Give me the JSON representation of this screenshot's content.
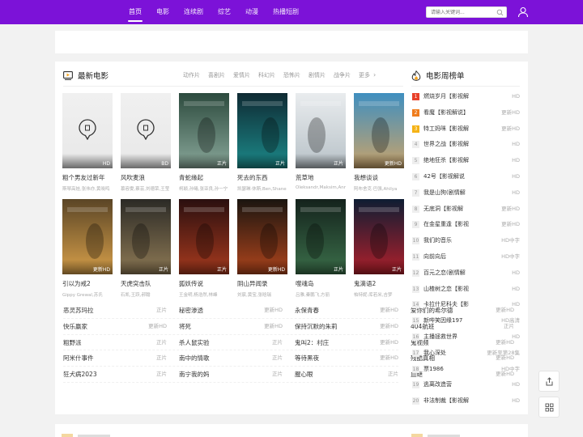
{
  "nav": {
    "items": [
      "首页",
      "电影",
      "连续剧",
      "综艺",
      "动漫",
      "热播短剧"
    ],
    "active": 0
  },
  "search": {
    "placeholder": "请输入关键词..."
  },
  "section": {
    "title": "最新电影",
    "categories": [
      "动作片",
      "喜剧片",
      "爱情片",
      "科幻片",
      "恐怖片",
      "剧情片",
      "战争片",
      "更多"
    ],
    "more_arrow": "›"
  },
  "cards": [
    {
      "title": "粗个男友过新年",
      "cast": "斯琴高娃,张伟亦,黄晓鸣",
      "badge": "HD",
      "placeholder": true,
      "colors": [
        "#f0f0f0",
        "#e8e8e8"
      ]
    },
    {
      "title": "风吹麦浪",
      "cast": "慕容雯,蔡芸,刘德荣,王莹",
      "badge": "BD",
      "placeholder": true,
      "colors": [
        "#f0f0f0",
        "#e8e8e8"
      ]
    },
    {
      "title": "青蛇缘起",
      "cast": "柯颖,孙曦,张亚良,孙一宁",
      "badge": "正片",
      "placeholder": false,
      "colors": [
        "#2c4a3e",
        "#8aa89a"
      ]
    },
    {
      "title": "死去的东西",
      "cast": "凯瑟琳·休斯,Ben,Shane",
      "badge": "正片",
      "placeholder": false,
      "colors": [
        "#0f2a33",
        "#1c8a8a"
      ]
    },
    {
      "title": "荒草地",
      "cast": "Oleksandr,Maksim,Anna",
      "badge": "正片",
      "placeholder": false,
      "colors": [
        "#e9ecee",
        "#b8c2c8"
      ]
    },
    {
      "title": "我想谈谈",
      "cast": "阿布舍克·巴强,Ahilya",
      "badge": "更新HD",
      "placeholder": false,
      "colors": [
        "#3f8fc0",
        "#c9a36a"
      ]
    },
    {
      "title": "引以为戒2",
      "cast": "Gippy Grewal,苏氏",
      "badge": "更新HD",
      "placeholder": false,
      "colors": [
        "#5a4526",
        "#d8a04a"
      ]
    },
    {
      "title": "天虎突击队",
      "cast": "石凯,王跃,郝翰",
      "badge": "正片",
      "placeholder": false,
      "colors": [
        "#2b2a26",
        "#8f7a55"
      ]
    },
    {
      "title": "狐妖传说",
      "cast": "王金明,杨浩然,林峰",
      "badge": "正片",
      "placeholder": false,
      "colors": [
        "#2a0f0f",
        "#a83a1e"
      ]
    },
    {
      "title": "阴山异闻录",
      "cast": "刘宸,黄宝,张晗瑞",
      "badge": "更新HD",
      "placeholder": false,
      "colors": [
        "#1a1510",
        "#b0451c"
      ]
    },
    {
      "title": "噬魂岛",
      "cast": "吕雅,秦鹏飞,方丽",
      "badge": "正片",
      "placeholder": false,
      "colors": [
        "#14221c",
        "#3b6f4a"
      ]
    },
    {
      "title": "鬼滴语2",
      "cast": "帕特妮·库若米,吉梦",
      "badge": "正片",
      "placeholder": false,
      "colors": [
        "#0e1d33",
        "#b1202b"
      ]
    }
  ],
  "list_rows": [
    [
      {
        "name": "恶灵苏玛拉",
        "note": "正片"
      },
      {
        "name": "秘密渗透",
        "note": "更新HD"
      },
      {
        "name": "永保青春",
        "note": "更新HD"
      },
      {
        "name": "爱你们的希尔德",
        "note": "更新HD"
      }
    ],
    [
      {
        "name": "快乐赢家",
        "note": "更新HD"
      },
      {
        "name": "将死",
        "note": "更新HD"
      },
      {
        "name": "保持沉默的朱莉",
        "note": "更新HD"
      },
      {
        "name": "404航班",
        "note": "正片"
      }
    ],
    [
      {
        "name": "粗野派",
        "note": "正片"
      },
      {
        "name": "杀人鼠实验",
        "note": "正片"
      },
      {
        "name": "鬼叫2：村庄",
        "note": "更新HD"
      },
      {
        "name": "鬼视频",
        "note": "更新HD"
      }
    ],
    [
      {
        "name": "阿米什事件",
        "note": "正片"
      },
      {
        "name": "南中的情歌",
        "note": "正片"
      },
      {
        "name": "等待黑夜",
        "note": "更新HD"
      },
      {
        "name": "残酷真相",
        "note": "更新HD"
      }
    ],
    [
      {
        "name": "狂犬病2023",
        "note": "正片"
      },
      {
        "name": "南宁我的妈",
        "note": "正片"
      },
      {
        "name": "腥心眼",
        "note": "正片"
      },
      {
        "name": "血继",
        "note": "更新HD"
      }
    ]
  ],
  "rank": {
    "title": "电影周榜单",
    "top_colors": [
      "#e8412a",
      "#ef7d1e",
      "#f5b316"
    ],
    "items": [
      {
        "num": "1",
        "name": "燃烧岁月【影视解",
        "note": "HD"
      },
      {
        "num": "2",
        "name": "看魔【影视解说】",
        "note": "更新HD"
      },
      {
        "num": "3",
        "name": "特工妈咪【影视解",
        "note": "更新HD"
      },
      {
        "num": "4",
        "name": "世界之战【影视解",
        "note": "HD"
      },
      {
        "num": "5",
        "name": "绝地狂杀【影视解",
        "note": "HD"
      },
      {
        "num": "6",
        "name": "42号【影视解说",
        "note": "HD"
      },
      {
        "num": "7",
        "name": "我是山狗(剧情解",
        "note": "HD"
      },
      {
        "num": "8",
        "name": "无底洞【影视解",
        "note": "更新HD"
      },
      {
        "num": "9",
        "name": "在金星重逢【影视",
        "note": "更新HD"
      },
      {
        "num": "10",
        "name": "我们的音乐",
        "note": "HD中字"
      },
      {
        "num": "11",
        "name": "向前向后",
        "note": "HD中字"
      },
      {
        "num": "12",
        "name": "百元之恋(剧情解",
        "note": "HD"
      },
      {
        "num": "13",
        "name": "山楂树之恋【影视",
        "note": "HD"
      },
      {
        "num": "14",
        "name": "卡拉什尼科夫【影",
        "note": "HD"
      },
      {
        "num": "15",
        "name": "新哔笑因缘197",
        "note": "HD高清"
      },
      {
        "num": "16",
        "name": "主播拯救世界",
        "note": "HD"
      },
      {
        "num": "17",
        "name": "我心深处",
        "note": "更新至第28集"
      },
      {
        "num": "18",
        "name": "票1986",
        "note": "HD中字"
      },
      {
        "num": "19",
        "name": "逃离改造营",
        "note": "HD"
      },
      {
        "num": "20",
        "name": "非法制裁【影视解",
        "note": "HD"
      }
    ]
  }
}
